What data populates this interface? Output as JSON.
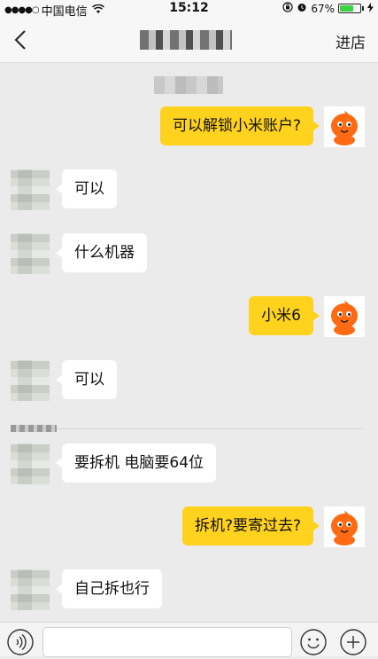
{
  "status_bar": {
    "signal_dots": "●●●●○",
    "carrier": "中国电信",
    "time": "15:12",
    "battery_percent": "67%",
    "battery_level": 0.67
  },
  "nav": {
    "right_action": "进店"
  },
  "messages": [
    {
      "side": "right",
      "text": "可以解锁小米账户?"
    },
    {
      "side": "left",
      "text": "可以"
    },
    {
      "side": "left",
      "text": "什么机器"
    },
    {
      "side": "right",
      "text": "小米6"
    },
    {
      "side": "left",
      "text": "可以"
    },
    {
      "side": "left",
      "text": "要拆机  电脑要64位"
    },
    {
      "side": "right",
      "text": "拆机?要寄过去?"
    },
    {
      "side": "left",
      "text": "自己拆也行"
    }
  ],
  "input": {
    "placeholder": ""
  }
}
